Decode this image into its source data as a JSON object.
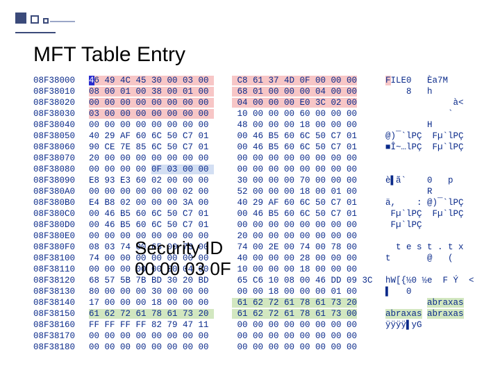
{
  "title": "MFT Table Entry",
  "overlay": {
    "line1": "Security ID",
    "line2": "00 00 03 0F"
  },
  "hex": {
    "offsets": [
      "08F38000",
      "08F38010",
      "08F38020",
      "08F38030",
      "08F38040",
      "08F38050",
      "08F38060",
      "08F38070",
      "08F38080",
      "08F38090",
      "08F380A0",
      "08F380B0",
      "08F380C0",
      "08F380D0",
      "08F380E0",
      "08F380F0",
      "08F38100",
      "08F38110",
      "08F38120",
      "08F38130",
      "08F38140",
      "08F38150",
      "08F38160",
      "08F38170",
      "08F38180"
    ],
    "left": [
      "46 49 4C 45 30 00 03 00 ",
      "08 00 01 00 38 00 01 00 ",
      "00 00 00 00 00 00 00 00 ",
      "03 00 00 00 00 00 00 00 ",
      "00 00 00 00 00 00 00 00 ",
      "40 29 AF 60 6C 50 C7 01 ",
      "90 CE 7E 85 6C 50 C7 01 ",
      "20 00 00 00 00 00 00 00 ",
      "00 00 00 00 0F 03 00 00 ",
      "E8 93 E3 60 02 00 00 00 ",
      "00 00 00 00 00 00 02 00 ",
      "E4 B8 02 00 00 00 3A 00 ",
      "00 46 B5 60 6C 50 C7 01 ",
      "00 46 B5 60 6C 50 C7 01 ",
      "00 00 00 00 00 00 00 00 ",
      "08 03 74 00 65 00 73 00 ",
      "74 00 00 00 00 00 00 00 ",
      "00 00 00 00 00 00 04 00 ",
      "68 57 5B 7B BD 30 20 BD ",
      "80 00 00 00 30 00 00 00 ",
      "17 00 00 00 18 00 00 00 ",
      "61 62 72 61 78 61 73 20 ",
      "FF FF FF FF 82 79 47 11 ",
      "00 00 00 00 00 00 00 00 ",
      "00 00 00 00 00 00 00 00 "
    ],
    "right": [
      " C8 61 37 4D 0F 00 00 00",
      " 68 01 00 00 00 04 00 00",
      " 04 00 00 00 E0 3C 02 00",
      " 10 00 00 00 60 00 00 00",
      " 48 00 00 00 18 00 00 00",
      " 00 46 B5 60 6C 50 C7 01",
      " 00 46 B5 60 6C 50 C7 01",
      " 00 00 00 00 00 00 00 00",
      " 00 00 00 00 00 00 00 00",
      " 30 00 00 00 70 00 00 00",
      " 52 00 00 00 18 00 01 00",
      " 40 29 AF 60 6C 50 C7 01",
      " 00 46 B5 60 6C 50 C7 01",
      " 00 00 00 00 00 00 00 00",
      " 20 00 00 00 00 00 00 00",
      " 74 00 2E 00 74 00 78 00",
      " 40 00 00 00 28 00 00 00",
      " 10 00 00 00 18 00 00 00",
      " 65 C6 10 08 00 46 DD 09 3C",
      " 00 00 18 00 00 00 01 00",
      " 61 62 72 61 78 61 73 20",
      " 61 62 72 61 78 61 73 00",
      " 00 00 00 00 00 00 00 00",
      " 00 00 00 00 00 00 00 00",
      " 00 00 00 00 00 00 00 00"
    ],
    "ascii": [
      "FILE0   Èa7M",
      "    8   h",
      "             à<",
      "            `",
      "        H",
      "@)¯`lPÇ  Fµ`lPÇ",
      "■Î~…lPÇ  Fµ`lPÇ",
      "",
      "",
      "è▌ã`    0   p",
      "        R",
      "ä,    : @)¯`lPÇ",
      " Fµ`lPÇ  Fµ`lPÇ",
      " Fµ`lPÇ",
      "",
      "  t e s t . t x",
      "t       @   (",
      "",
      "hW[{½0 ½e  F Ý  <",
      "▌   0",
      "        abraxas",
      "abraxas abraxas",
      "ÿÿÿÿ▌yG",
      "",
      ""
    ]
  },
  "highlights": {
    "pinkRows": [
      0,
      1,
      2,
      3
    ],
    "pinkRow3Cols": 8,
    "greenCell": {
      "row": 0,
      "col": 0
    },
    "blueSpan": {
      "row": 8,
      "startCol": 4,
      "endCol": 7
    },
    "asciiPinkRow0": true,
    "yellowLeft": [
      20,
      21
    ],
    "yellowRight": [
      21
    ],
    "yellowAscii": [
      20,
      21
    ]
  }
}
